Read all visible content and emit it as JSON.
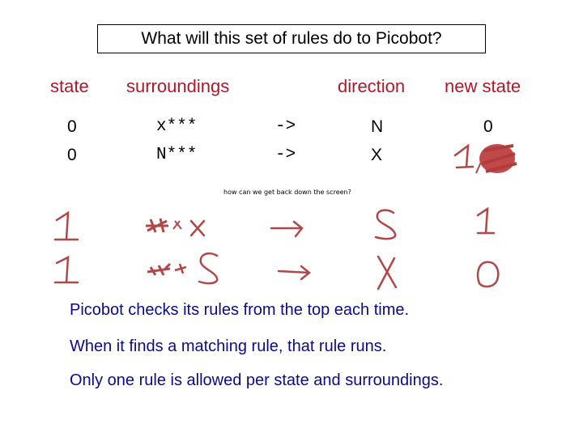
{
  "title": "What will this set of rules do to Picobot?",
  "headers": {
    "state": "state",
    "surroundings": "surroundings",
    "direction": "direction",
    "new_state": "new state"
  },
  "rules": [
    {
      "state": "0",
      "surroundings": "x***",
      "arrow": "->",
      "direction": "N",
      "new_state": "0"
    },
    {
      "state": "0",
      "surroundings": "N***",
      "arrow": "->",
      "direction": "X",
      "new_state": "1"
    }
  ],
  "handwritten": {
    "note": "how can we get back down the screen?",
    "rows": [
      {
        "state": "1",
        "surroundings": "***x",
        "arrow": "→",
        "direction": "S",
        "new_state": "1"
      },
      {
        "state": "1",
        "surroundings": "***S",
        "arrow": "→",
        "direction": "X",
        "new_state": "0"
      }
    ],
    "ink_color": "#b04848"
  },
  "body_lines": [
    "Picobot checks its rules from the top each time.",
    "When it finds a matching rule, that rule runs.",
    "Only one rule is allowed per state and surroundings."
  ],
  "colors": {
    "header": "#b01828",
    "body_text": "#0b0b8a",
    "ink": "#b04848"
  }
}
